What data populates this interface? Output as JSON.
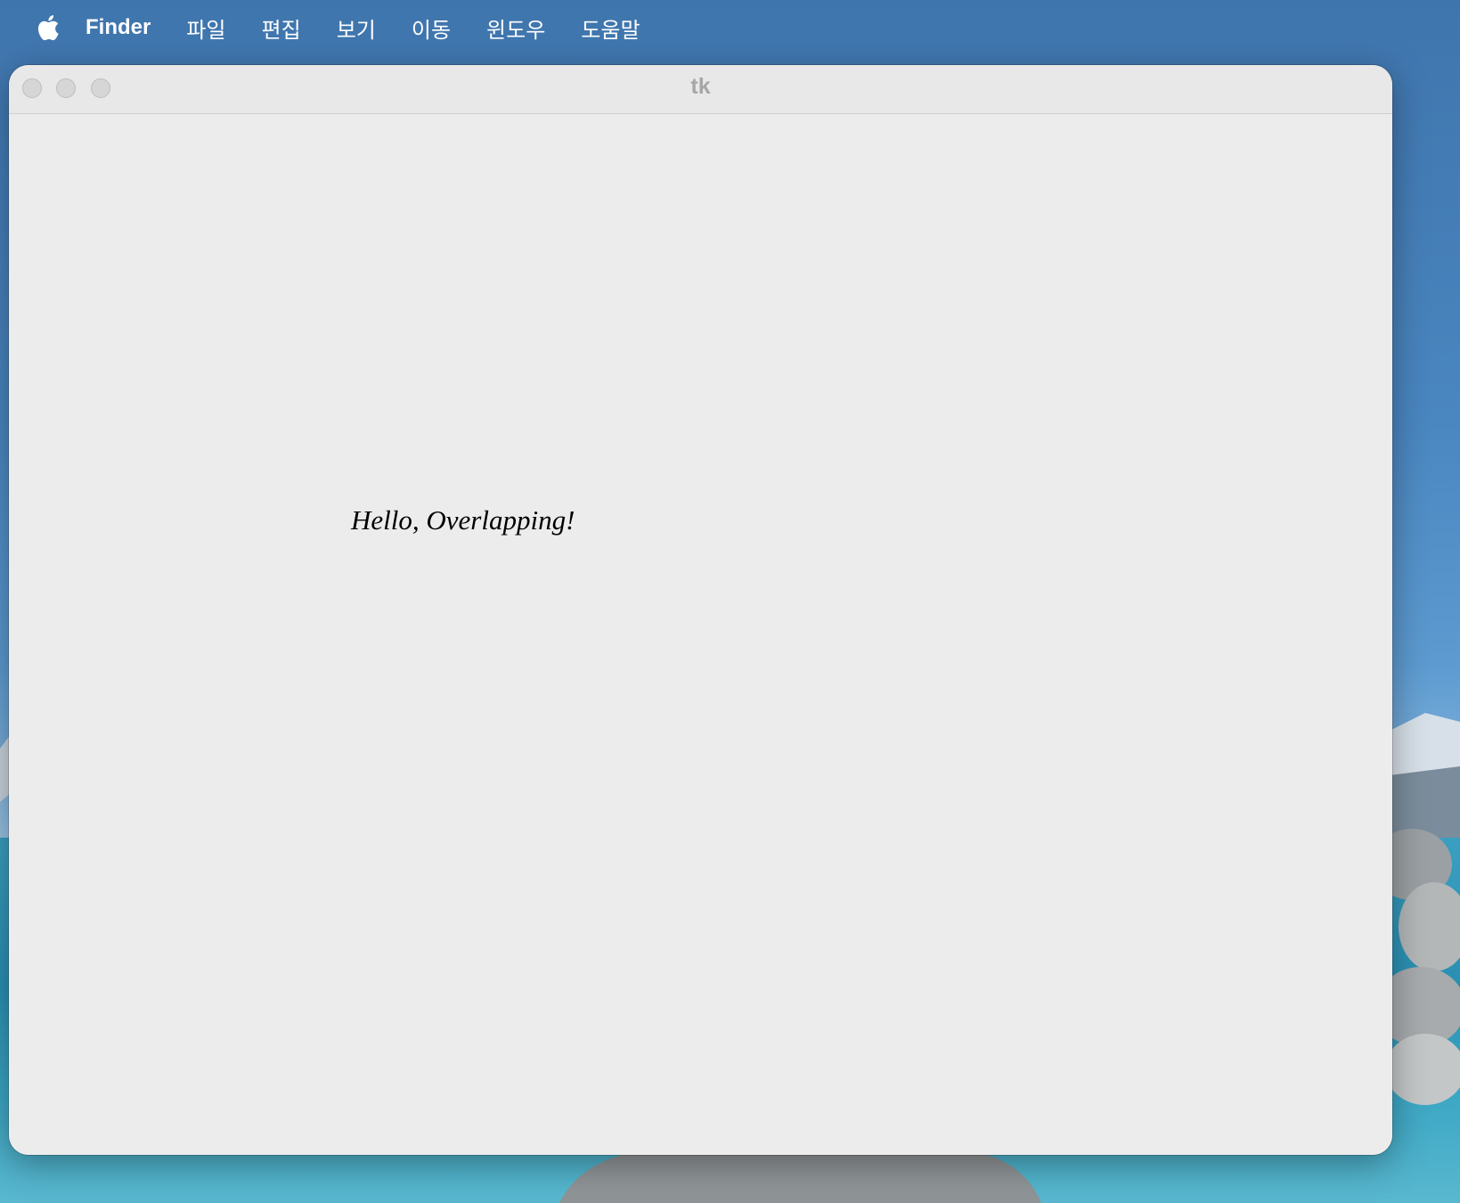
{
  "menubar": {
    "apple_icon": "apple-logo-icon",
    "app_name": "Finder",
    "items": [
      "파일",
      "편집",
      "보기",
      "이동",
      "윈도우",
      "도움말"
    ]
  },
  "window": {
    "title": "tk",
    "buttons": [
      "close",
      "minimize",
      "zoom"
    ],
    "canvas_text": "Hello, Overlapping!"
  },
  "colors": {
    "menubar_text": "#ffffff",
    "window_bg": "#ececec",
    "titlebar_text": "#a6a6a6",
    "traffic_light_inactive": "#d6d6d6"
  }
}
